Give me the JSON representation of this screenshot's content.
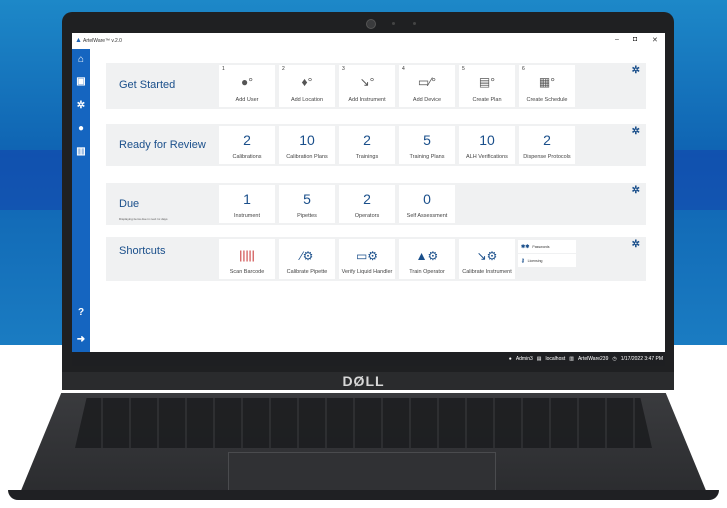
{
  "app": {
    "title": "ArtelWare™ v.2.0"
  },
  "window": {
    "minimize": "–",
    "maximize": "◘",
    "close": "✕"
  },
  "brand": {
    "laptop_logo": "DØLL"
  },
  "sections": {
    "get_started": {
      "title": "Get Started",
      "cards": [
        {
          "num": "1",
          "label": "Add User",
          "icon": "user-add-icon"
        },
        {
          "num": "2",
          "label": "Add Location",
          "icon": "location-add-icon"
        },
        {
          "num": "3",
          "label": "Add Instrument",
          "icon": "pipette-add-icon"
        },
        {
          "num": "4",
          "label": "Add Device",
          "icon": "device-add-icon"
        },
        {
          "num": "5",
          "label": "Create Plan",
          "icon": "plan-create-icon"
        },
        {
          "num": "6",
          "label": "Create Schedule",
          "icon": "calendar-create-icon"
        }
      ]
    },
    "ready_for_review": {
      "title": "Ready for Review",
      "cards": [
        {
          "value": "2",
          "label": "Calibrations"
        },
        {
          "value": "10",
          "label": "Calibration Plans"
        },
        {
          "value": "2",
          "label": "Trainings"
        },
        {
          "value": "5",
          "label": "Training Plans"
        },
        {
          "value": "10",
          "label": "ALH Verifications"
        },
        {
          "value": "2",
          "label": "Dispense Protocols"
        }
      ]
    },
    "due": {
      "title": "Due",
      "subtitle": "Displaying items due in next 1x days",
      "cards": [
        {
          "value": "1",
          "label": "Instrument"
        },
        {
          "value": "5",
          "label": "Pipettes"
        },
        {
          "value": "2",
          "label": "Operators"
        },
        {
          "value": "0",
          "label": "Self Assessment"
        }
      ]
    },
    "shortcuts": {
      "title": "Shortcuts",
      "cards": [
        {
          "label": "Scan Barcode",
          "icon": "barcode-icon"
        },
        {
          "label": "Calibrate Pipette",
          "icon": "pipette-calibrate-icon"
        },
        {
          "label": "Verify Liquid Handler",
          "icon": "liquid-handler-icon"
        },
        {
          "label": "Train Operator",
          "icon": "graduation-cap-icon"
        },
        {
          "label": "Calibrate Instrument",
          "icon": "instrument-calibrate-icon"
        }
      ],
      "mini": [
        {
          "label": "Passwords",
          "icon": "key-icon"
        },
        {
          "label": "Licensing",
          "icon": "license-key-icon"
        }
      ]
    }
  },
  "status": {
    "user": "Admin3",
    "server": "localhost",
    "database": "ArtelWare239",
    "datetime": "1/17/2022 3:47 PM"
  }
}
